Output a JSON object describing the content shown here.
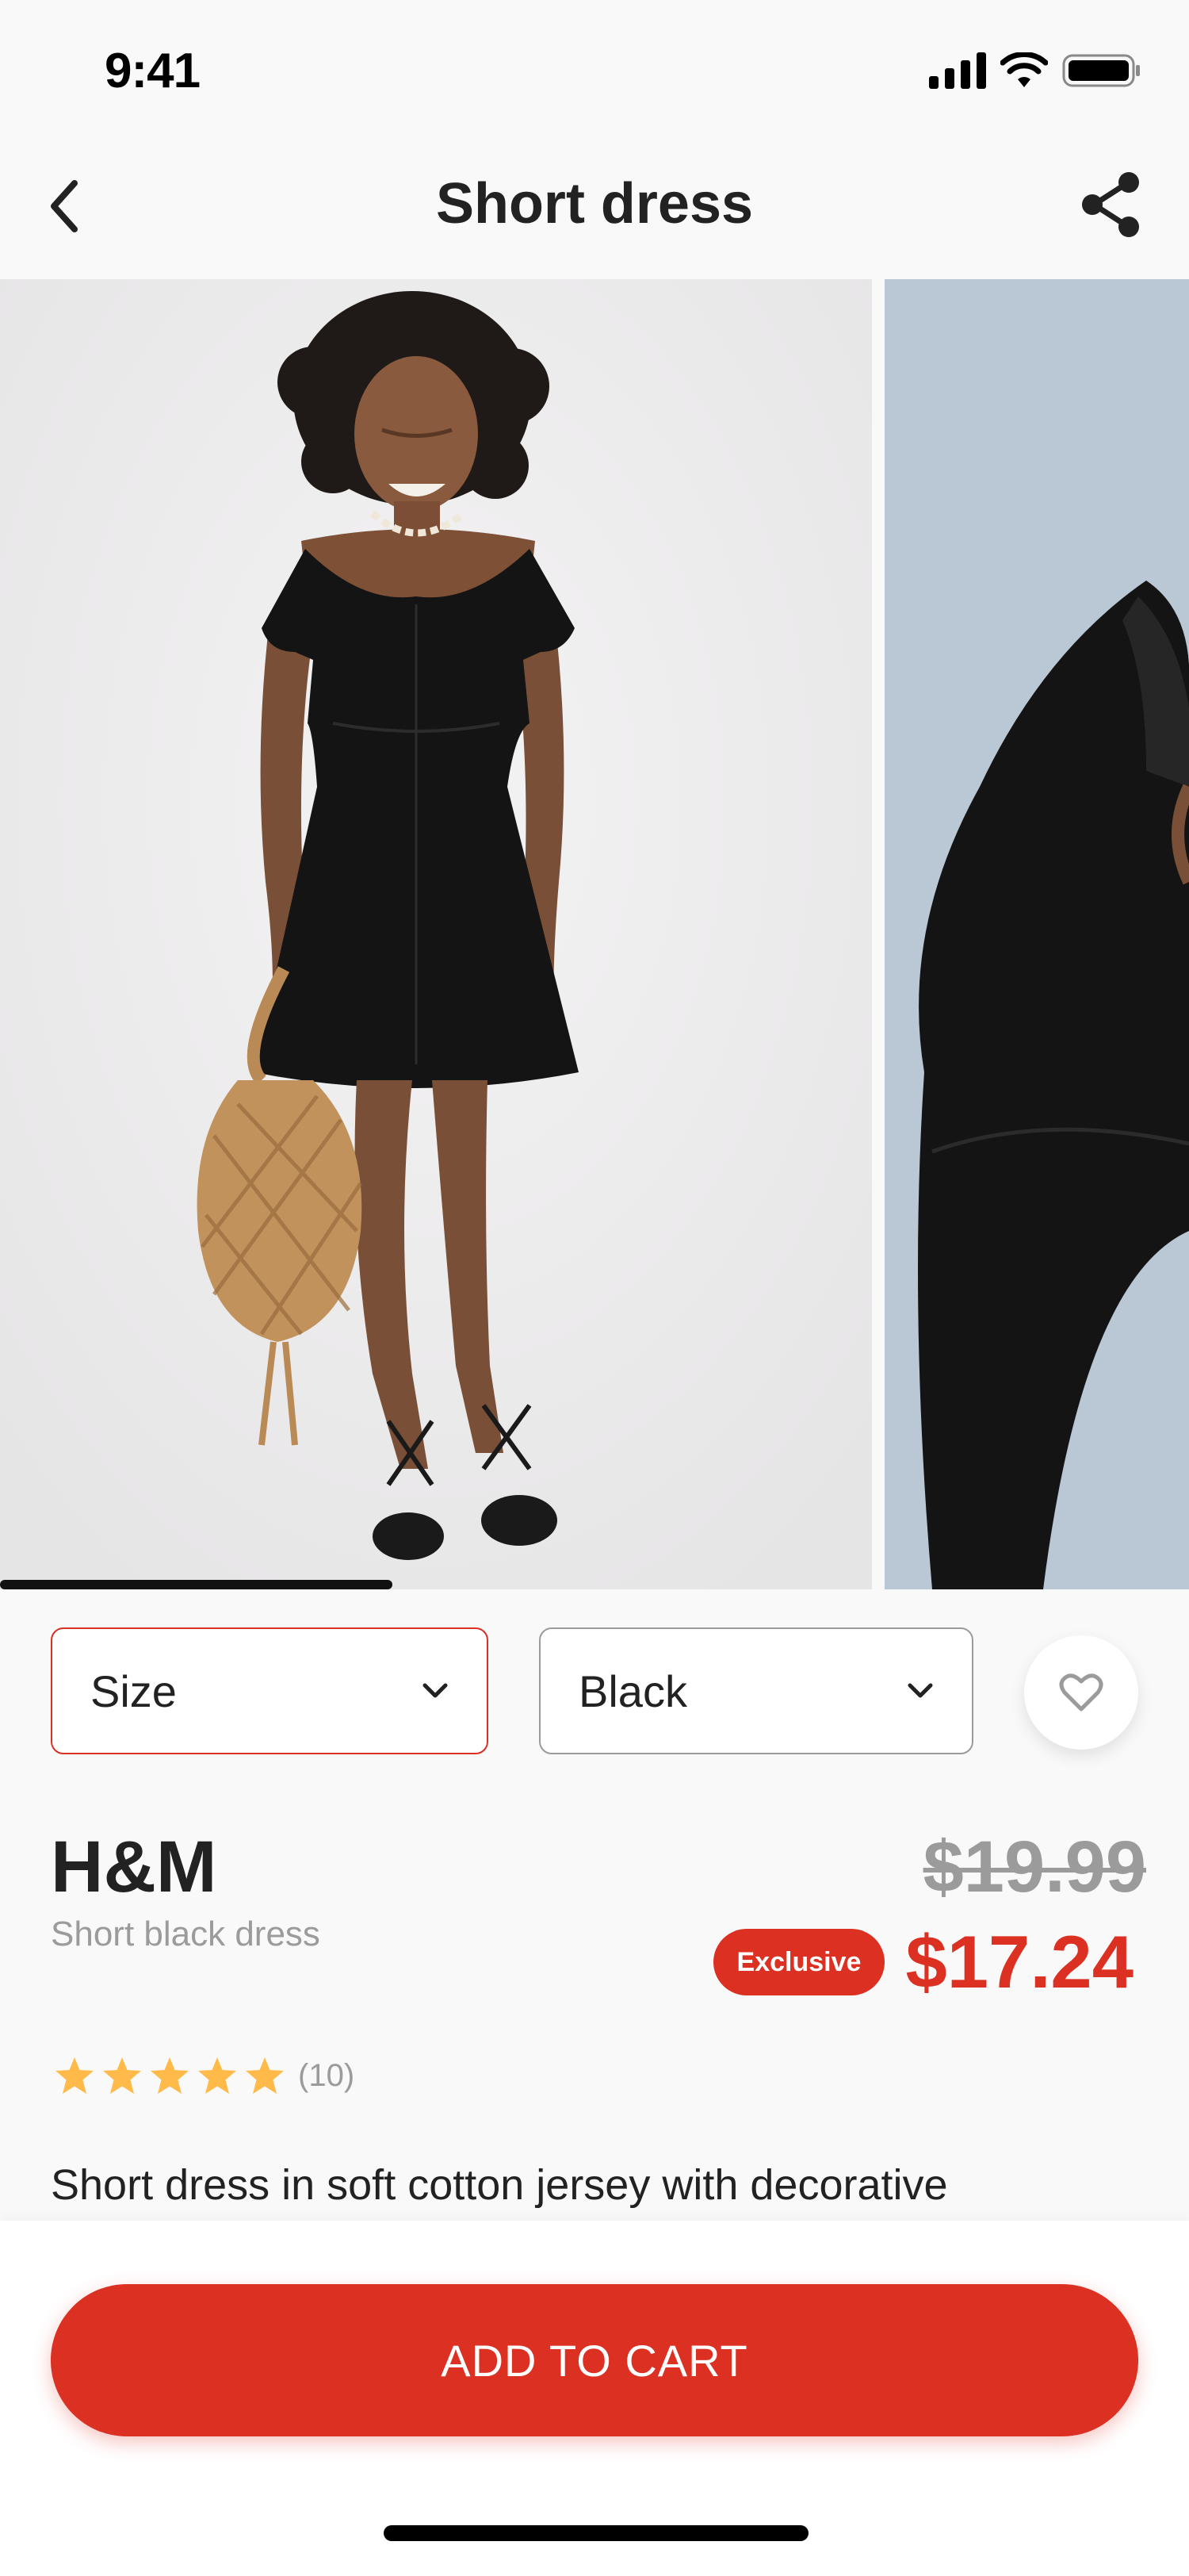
{
  "status_bar": {
    "time": "9:41"
  },
  "nav": {
    "title": "Short dress"
  },
  "selectors": {
    "size_label": "Size",
    "color_label": "Black"
  },
  "product": {
    "brand": "H&M",
    "subtitle": "Short black dress",
    "old_price": "$19.99",
    "badge": "Exclusive",
    "price": "$17.24",
    "rating_stars": 5,
    "rating_count": "(10)",
    "description": "Short dress in soft cotton jersey with decorative"
  },
  "gallery": {
    "position_fraction": 0.33
  },
  "cart": {
    "label": "ADD TO CART"
  },
  "colors": {
    "accent": "#DB3022",
    "star": "#FFBA49",
    "muted": "#9B9B9B"
  },
  "icons": [
    "back-chevron-icon",
    "share-icon",
    "chevron-down-icon",
    "heart-icon",
    "star-icon"
  ]
}
